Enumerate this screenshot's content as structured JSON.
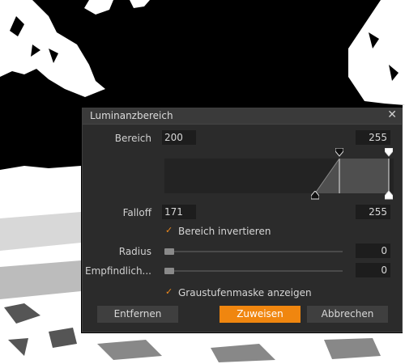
{
  "dialog": {
    "title": "Luminanzbereich",
    "close_glyph": "✕",
    "range": {
      "label": "Bereich",
      "low": "200",
      "high": "255"
    },
    "falloff": {
      "label": "Falloff",
      "low": "171",
      "high": "255"
    },
    "invert": {
      "label": "Bereich invertieren",
      "checked": true
    },
    "radius": {
      "label": "Radius",
      "value": "0",
      "level": 0
    },
    "sensitivity": {
      "label": "Empfindlich...",
      "value": "0",
      "level": 0
    },
    "grayscale_mask": {
      "label": "Graustufenmaske anzeigen",
      "checked": true
    },
    "buttons": {
      "remove": "Entfernen",
      "apply": "Zuweisen",
      "cancel": "Abbrechen"
    },
    "colors": {
      "accent": "#f0860f",
      "panel": "#2b2b2b",
      "field": "#1d1d1d"
    }
  }
}
